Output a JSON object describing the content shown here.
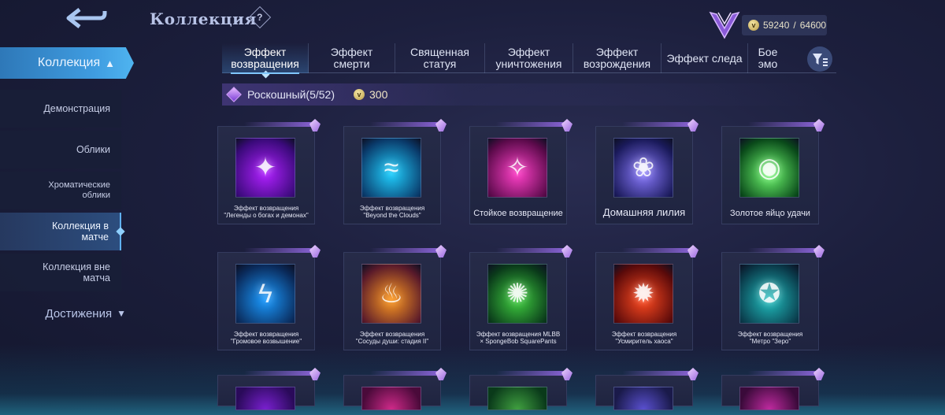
{
  "header": {
    "title": "Коллекция",
    "help_glyph": "?",
    "back_icon": "back-arrow-icon",
    "currency": {
      "current": "59240",
      "max": "64600"
    }
  },
  "sidebar": {
    "main_label": "Коллекция",
    "items": [
      {
        "label": "Демонстрация",
        "active": false
      },
      {
        "label": "Облики",
        "active": false
      },
      {
        "label": "Хроматические облики",
        "active": false
      },
      {
        "label": "Коллекция в матче",
        "active": true
      },
      {
        "label": "Коллекция вне матча",
        "active": false
      }
    ],
    "achievements_label": "Достижения"
  },
  "tabs": [
    {
      "label": "Эффект возвращения",
      "active": true
    },
    {
      "label": "Эффект смерти",
      "active": false
    },
    {
      "label": "Священная статуя",
      "active": false
    },
    {
      "label": "Эффект уничтожения",
      "active": false
    },
    {
      "label": "Эффект возрождения",
      "active": false
    },
    {
      "label": "Эффект следа",
      "active": false
    },
    {
      "label": "Бое эмо",
      "active": false
    }
  ],
  "section": {
    "label": "Роскошный(5/52)",
    "price": "300"
  },
  "cards": [
    {
      "label": "Эффект возвращения\n\"Легенды о богах и демонах\"",
      "size": "small",
      "glyph": "✦",
      "colors": [
        "#b020ff",
        "#3a0a7a"
      ]
    },
    {
      "label": "Эффект возвращения\n\"Beyond the Clouds\"",
      "size": "small",
      "glyph": "≈",
      "colors": [
        "#20d0ff",
        "#0a3a6a"
      ]
    },
    {
      "label": "Стойкое возвращение",
      "size": "large",
      "glyph": "✧",
      "colors": [
        "#ff40c8",
        "#5a0a4a"
      ]
    },
    {
      "label": "Домашняя лилия",
      "size": "xlarge",
      "glyph": "❀",
      "colors": [
        "#8a7aff",
        "#1a1a5a"
      ]
    },
    {
      "label": "Золотое яйцо удачи",
      "size": "large",
      "glyph": "◉",
      "colors": [
        "#70ff70",
        "#0a4a1a"
      ]
    },
    {
      "label": "Эффект возвращения\n\"Громовое возвышение\"",
      "size": "small",
      "glyph": "ϟ",
      "colors": [
        "#1a9aff",
        "#0a2a5a"
      ]
    },
    {
      "label": "Эффект возвращения\n\"Сосуды души: стадия II\"",
      "size": "small",
      "glyph": "♨",
      "colors": [
        "#ff9a20",
        "#5a1a2a"
      ]
    },
    {
      "label": "Эффект возвращения MLBB\n× SpongeBob SquarePants",
      "size": "small",
      "glyph": "✺",
      "colors": [
        "#40d040",
        "#0a3a1a"
      ]
    },
    {
      "label": "Эффект возвращения\n\"Усмиритель хаоса\"",
      "size": "small",
      "glyph": "✹",
      "colors": [
        "#ff4a20",
        "#5a0a0a"
      ]
    },
    {
      "label": "Эффект возвращения\n\"Метро \"Зеро\"",
      "size": "small",
      "glyph": "✪",
      "colors": [
        "#20c0c0",
        "#0a3a4a"
      ]
    }
  ],
  "partial_row_colors": [
    [
      "#7a20d0",
      "#2a0a5a"
    ],
    [
      "#d02a8a",
      "#4a0a3a"
    ],
    [
      "#40a040",
      "#0a3a1a"
    ],
    [
      "#5a50d0",
      "#1a1a4a"
    ],
    [
      "#c02aa0",
      "#3a0a3a"
    ]
  ],
  "icons": {
    "sort": "filter-sort-icon",
    "gem": "purple-gem-icon",
    "coin": "coin-icon"
  },
  "colors": {
    "accent_blue": "#3f9ce0",
    "gem_purple": "#9a6ae0"
  }
}
